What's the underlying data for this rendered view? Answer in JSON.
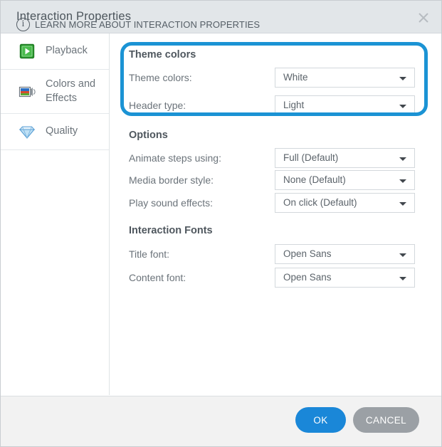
{
  "window": {
    "title": "Interaction Properties",
    "close_icon": "close-icon"
  },
  "sidebar": {
    "items": [
      {
        "label": "Playback",
        "icon": "play-button-icon"
      },
      {
        "label": "Colors and Effects",
        "icon": "colors-effects-icon"
      },
      {
        "label": "Quality",
        "icon": "diamond-icon"
      }
    ]
  },
  "main": {
    "sections": [
      {
        "title": "Theme colors",
        "highlighted": true,
        "fields": [
          {
            "label": "Theme colors:",
            "value": "White"
          },
          {
            "label": "Header type:",
            "value": "Light"
          }
        ]
      },
      {
        "title": "Options",
        "highlighted": false,
        "fields": [
          {
            "label": "Animate steps using:",
            "value": "Full (Default)"
          },
          {
            "label": "Media border style:",
            "value": "None (Default)"
          },
          {
            "label": "Play sound effects:",
            "value": "On click (Default)"
          }
        ]
      },
      {
        "title": "Interaction Fonts",
        "highlighted": false,
        "fields": [
          {
            "label": "Title font:",
            "value": "Open Sans"
          },
          {
            "label": "Content font:",
            "value": "Open Sans"
          }
        ]
      }
    ]
  },
  "footer": {
    "learn_more": "LEARN MORE ABOUT INTERACTION PROPERTIES",
    "info_icon": "info-circle-icon",
    "ok_label": "OK",
    "cancel_label": "CANCEL"
  },
  "colors": {
    "accent": "#1a87d8",
    "highlight_ring": "#1b93d4",
    "cancel_button": "#9ba0a5",
    "titlebar": "#e2e6e9",
    "footer": "#f2f2f2"
  }
}
